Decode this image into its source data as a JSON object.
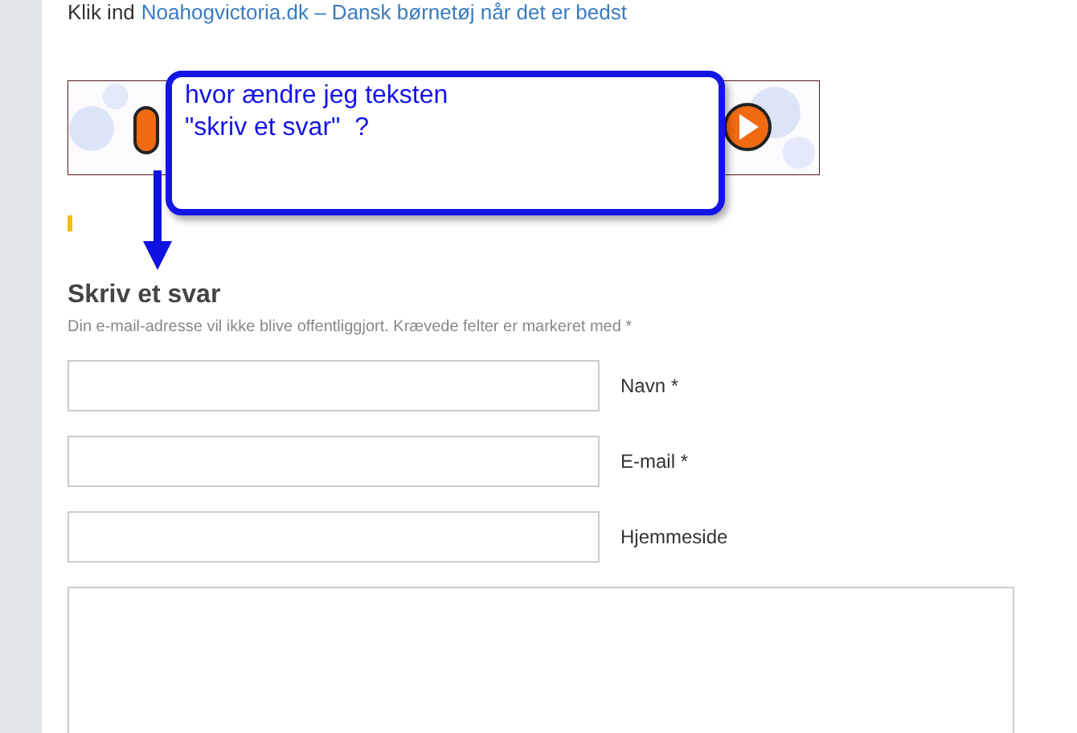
{
  "intro": {
    "prefix": "Klik ind",
    "link": "Noahogvictoria.dk – Dansk børnetøj når det er bedst"
  },
  "callout": {
    "lines": [
      "hvor ændre jeg teksten",
      "\"skriv et svar\"  ?"
    ]
  },
  "reply_form": {
    "title": "Skriv et svar",
    "note": "Din e-mail-adresse vil ikke blive offentliggjort. Krævede felter er markeret med *",
    "fields": [
      {
        "label": "Navn *"
      },
      {
        "label": "E-mail *"
      },
      {
        "label": "Hjemmeside"
      }
    ]
  }
}
